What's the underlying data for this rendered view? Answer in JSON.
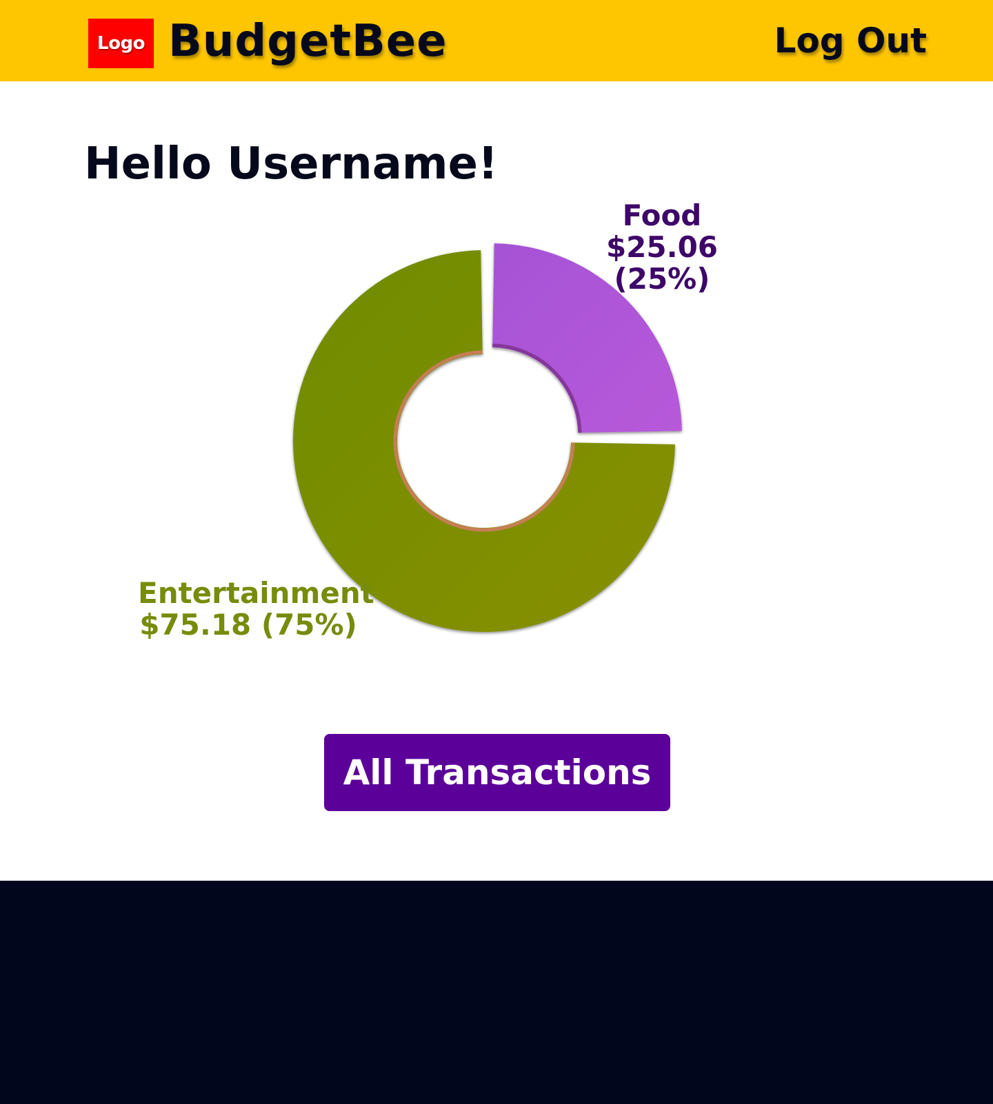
{
  "header": {
    "logo_text": "Logo",
    "brand": "BudgetBee",
    "logout_label": "Log Out"
  },
  "main": {
    "greeting": "Hello Username!",
    "cta_label": "All Transactions"
  },
  "colors": {
    "header_bg": "#fec600",
    "logo_bg": "#ff0000",
    "cta_bg": "#5b0199",
    "footer_bg": "#02061c",
    "food": "#b057d8",
    "entertainment": "#7a8f00"
  },
  "chart_data": {
    "type": "pie",
    "donut": true,
    "categories": [
      "Food",
      "Entertainment"
    ],
    "values": [
      25.06,
      75.18
    ],
    "display_values": [
      "$25.06 (25%)",
      "$75.18 (75%)"
    ],
    "percentages": [
      25,
      75
    ],
    "colors": [
      "#b057d8",
      "#7a8f00"
    ],
    "label_colors": [
      "#3e0669",
      "#768c0a"
    ]
  }
}
